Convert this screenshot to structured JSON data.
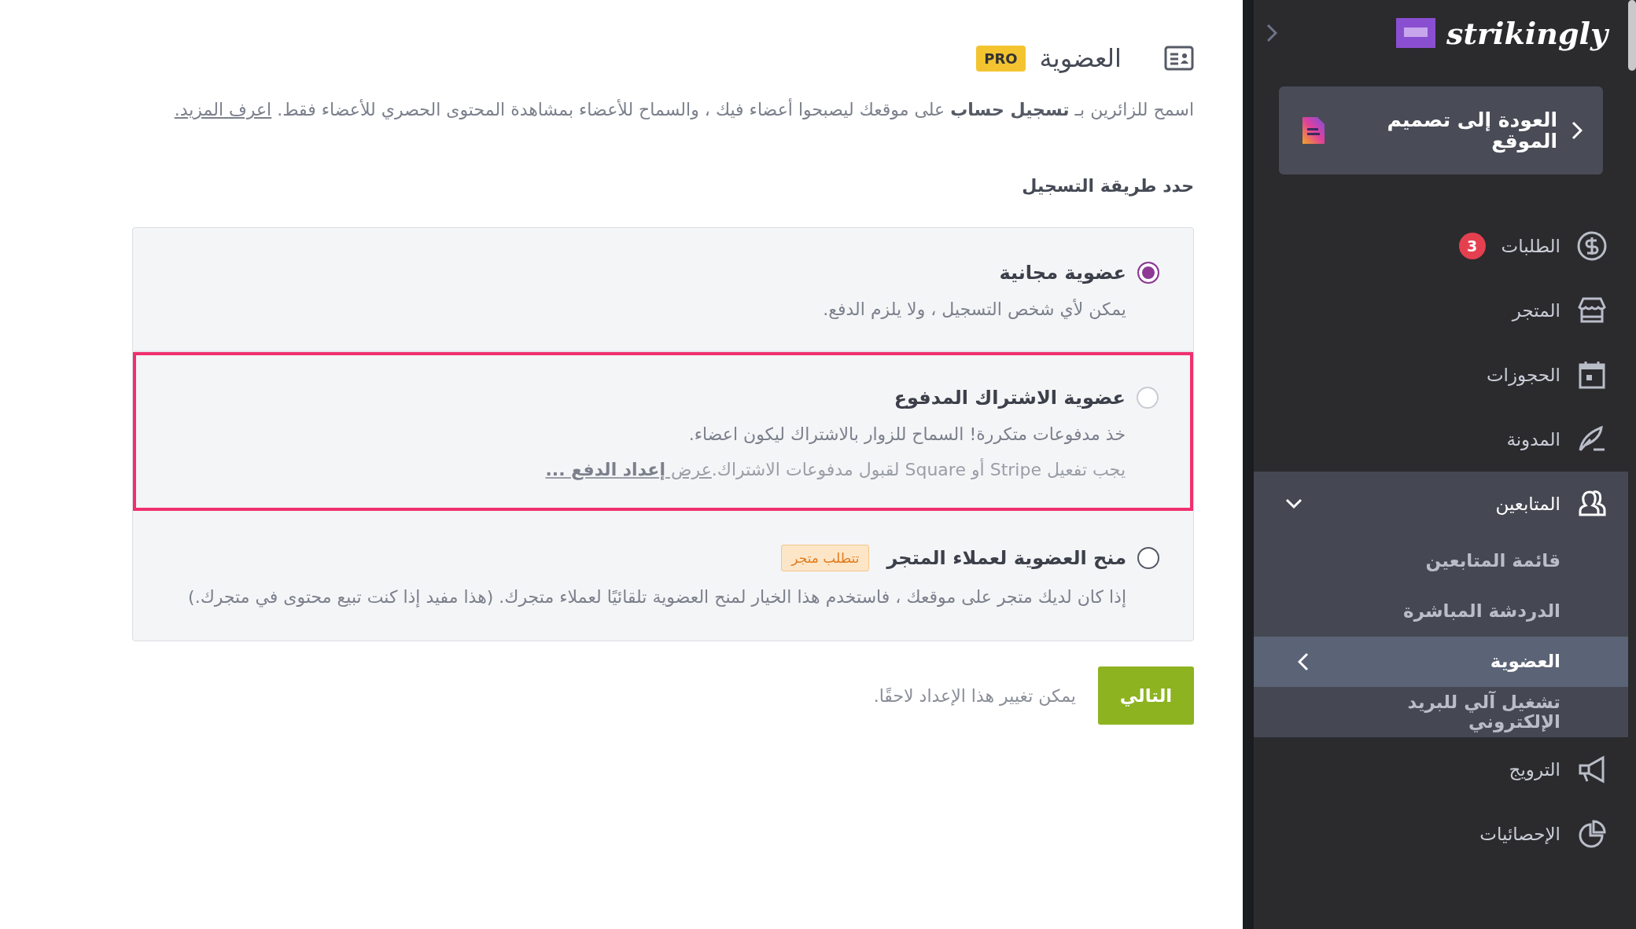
{
  "main": {
    "header": {
      "title": "العضوية",
      "badge": "PRO"
    },
    "description": {
      "text": "اسمح للزائرين بـ **تسجيل حساب** على موقعك ليصبحوا أعضاء فيك ، والسماح للأعضاء بمشاهدة المحتوى الحصري للأعضاء فقط.",
      "link": "اعرف المزيد."
    },
    "section_label": "حدد طريقة التسجيل",
    "options": [
      {
        "title": "عضوية مجانية",
        "selected": true,
        "disabled": false,
        "highlighted": false,
        "description": "يمكن لأي شخص التسجيل ، ولا يلزم الدفع."
      },
      {
        "title": "عضوية الاشتراك المدفوع",
        "selected": false,
        "disabled": true,
        "highlighted": true,
        "description": "خذ مدفوعات متكررة! السماح للزوار بالاشتراك ليكون اعضاء.",
        "note": "يجب تفعيل Stripe أو Square لقبول مدفوعات الاشتراك.",
        "note_link": "عرض **إعداد الدفع ...**"
      },
      {
        "title": "منح العضوية لعملاء المتجر",
        "selected": false,
        "disabled": false,
        "highlighted": false,
        "tag": "تتطلب متجر",
        "description": "إذا كان لديك متجر على موقعك ، فاستخدم هذا الخيار لمنح العضوية تلقائيًا لعملاء متجرك. (هذا مفيد إذا كنت تبيع محتوى في متجرك.)"
      }
    ],
    "footer": {
      "next_button": "التالي",
      "hint": "يمكن تغيير هذا الإعداد لاحقًا."
    }
  },
  "sidebar": {
    "logo": "strikingly",
    "back_card": "العودة إلى تصميم الموقع",
    "items": [
      {
        "label": "الطلبات",
        "badge": "3",
        "expanded": false
      },
      {
        "label": "المتجر",
        "expanded": false
      },
      {
        "label": "الحجوزات",
        "expanded": false
      },
      {
        "label": "المدونة",
        "expanded": false
      },
      {
        "label": "المتابعين",
        "expanded": true,
        "children": [
          {
            "label": "قائمة المتابعين",
            "selected": false
          },
          {
            "label": "الدردشة المباشرة",
            "selected": false
          },
          {
            "label": "العضوية",
            "selected": true
          },
          {
            "label": "تشغيل آلي للبريد الإلكتروني",
            "selected": false
          }
        ]
      },
      {
        "label": "الترويج",
        "expanded": false
      },
      {
        "label": "الإحصائيات",
        "expanded": false
      }
    ]
  }
}
